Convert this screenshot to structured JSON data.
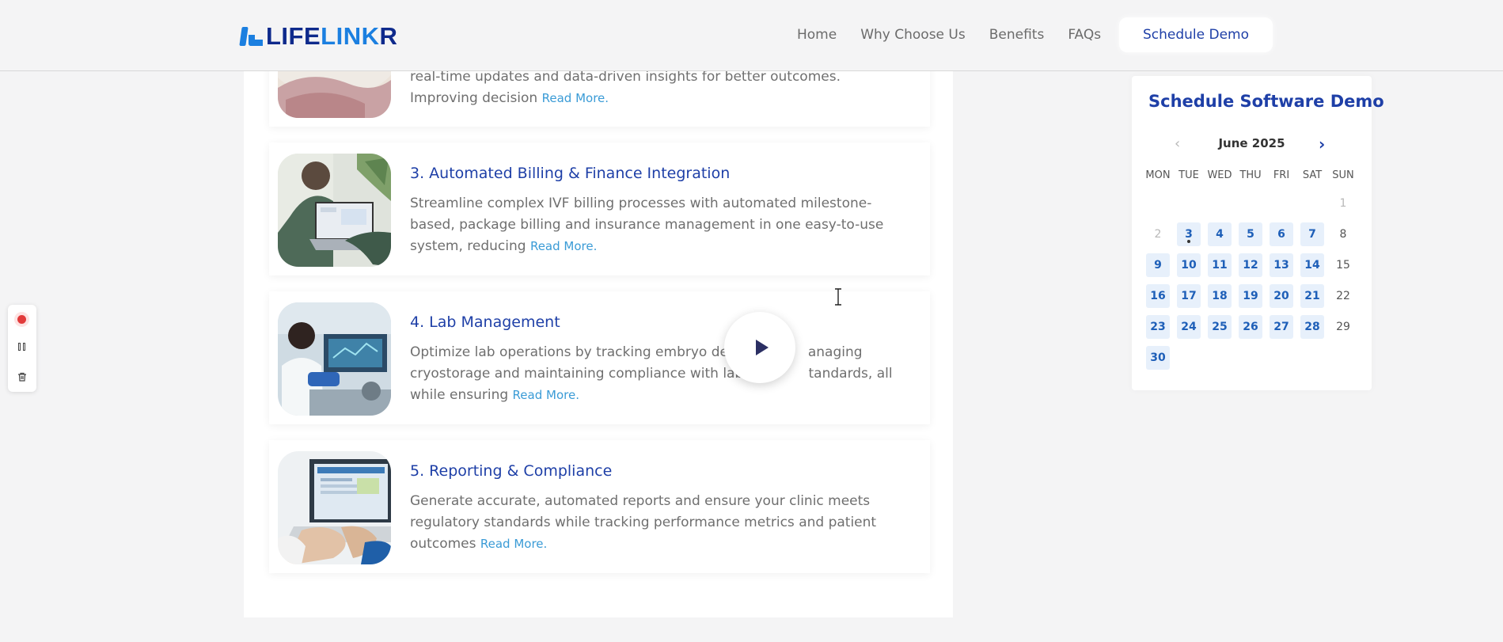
{
  "header": {
    "logo": {
      "part1": "LIFE",
      "part2": "LINK",
      "part3": "R"
    },
    "nav": [
      "Home",
      "Why Choose Us",
      "Benefits",
      "FAQs"
    ],
    "cta": "Schedule Demo"
  },
  "cards": [
    {
      "title": "",
      "text": "real-time updates and data-driven insights for better outcomes. Improving decision",
      "read_more": "Read More."
    },
    {
      "title": "3.  Automated Billing & Finance Integration",
      "text": "Streamline complex IVF billing processes with automated milestone-based, package billing and insurance management in one easy-to-use system, reducing",
      "read_more": "Read More."
    },
    {
      "title": "4.  Lab Management",
      "text": "Optimize lab operations by tracking embryo devel              anaging cryostorage and maintaining compliance with labor            tandards, all while ensuring",
      "read_more": "Read More."
    },
    {
      "title": "5.  Reporting & Compliance",
      "text": "Generate accurate, automated reports and ensure your clinic meets regulatory standards while tracking performance metrics and patient outcomes",
      "read_more": "Read More."
    }
  ],
  "calendar": {
    "title": "Schedule Software Demo",
    "month": "June 2025",
    "weekdays": [
      "MON",
      "TUE",
      "WED",
      "THU",
      "FRI",
      "SAT",
      "SUN"
    ],
    "first_weekday_index": 6,
    "days_in_month": 30,
    "available_days": [
      3,
      4,
      5,
      6,
      7,
      9,
      10,
      11,
      12,
      13,
      14,
      16,
      17,
      18,
      19,
      20,
      21,
      23,
      24,
      25,
      26,
      27,
      28,
      30
    ],
    "muted_days": [
      1,
      2
    ],
    "today": 3
  },
  "icons": {
    "prev": "chevron-left-icon",
    "next": "chevron-right-icon",
    "play": "play-icon",
    "record": "record-icon",
    "pause": "pause-icon",
    "trash": "trash-icon",
    "cursor": "text-cursor-icon"
  },
  "colors": {
    "brand_dark": "#0e2a8c",
    "brand_light": "#1b7fe0",
    "title_blue": "#1e3fa7",
    "link_blue": "#3a9bd6",
    "available_bg": "#e7f0fb"
  }
}
